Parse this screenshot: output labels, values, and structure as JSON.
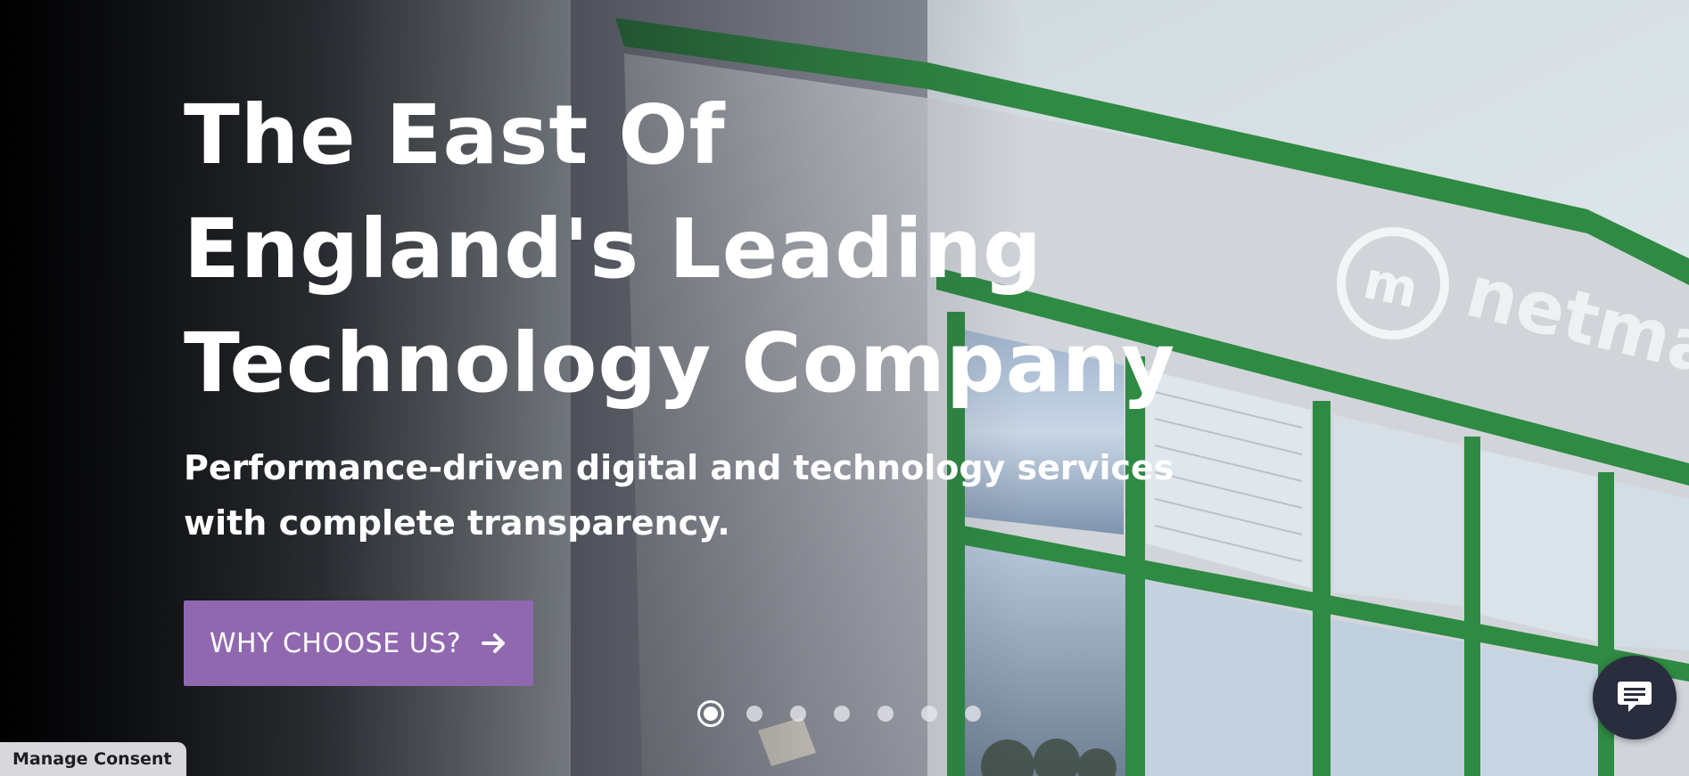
{
  "hero": {
    "title": "The East Of England's Leading Technology Company",
    "subtitle": "Performance-driven digital and technology services with complete transparency.",
    "cta_label": "WHY CHOOSE US?",
    "building_sign": "netmat"
  },
  "carousel": {
    "slide_count": 7,
    "active_index": 0
  },
  "consent": {
    "label": "Manage Consent"
  },
  "icons": {
    "cta": "arrow-right-icon",
    "chat": "chat-bubble-icon",
    "logo": "netmatters-logo-icon"
  },
  "colors": {
    "cta_background": "#9068b0",
    "chat_background": "#2a2d3e",
    "building_green": "#2f8a43",
    "consent_background": "#d7d7dc"
  }
}
